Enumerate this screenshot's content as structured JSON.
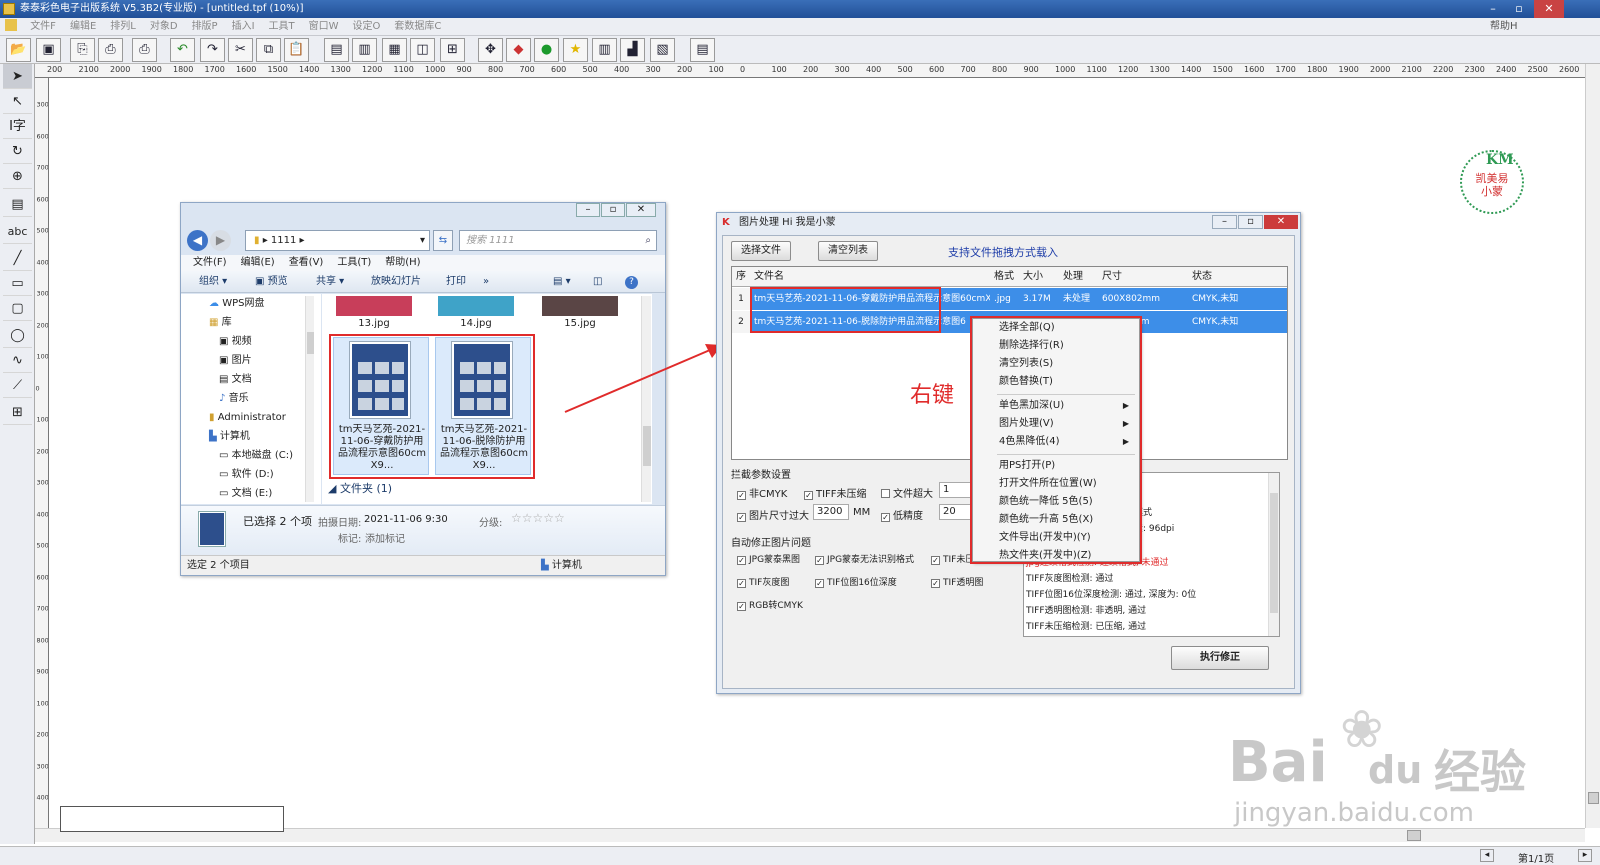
{
  "app": {
    "title": "泰泰彩色电子出版系统 V5.3B2(专业版) - [untitled.tpf (10%)]",
    "menu": [
      "文件F",
      "编辑E",
      "排列L",
      "对象D",
      "排版P",
      "插入I",
      "工具T",
      "窗口W",
      "设定O",
      "套数据库C"
    ],
    "help": "帮助H",
    "status_page": "第1/1页"
  },
  "ruler": {
    "h": [
      "200",
      "2100",
      "2000",
      "1900",
      "1800",
      "1700",
      "1600",
      "1500",
      "1400",
      "1300",
      "1200",
      "1100",
      "1000",
      "900",
      "800",
      "700",
      "600",
      "500",
      "400",
      "300",
      "200",
      "100",
      "0",
      "100",
      "200",
      "300",
      "400",
      "500",
      "600",
      "700",
      "800",
      "900",
      "1000",
      "1100",
      "1200",
      "1300",
      "1400",
      "1500",
      "1600",
      "1700",
      "1800",
      "1900",
      "2000",
      "2100",
      "2200",
      "2300",
      "2400",
      "2500",
      "2600"
    ],
    "v": [
      "300",
      "600",
      "700",
      "600",
      "500",
      "400",
      "300",
      "200",
      "100",
      "0",
      "100",
      "200",
      "300",
      "400",
      "500",
      "600",
      "700",
      "800",
      "900",
      "100",
      "200",
      "300",
      "400"
    ]
  },
  "logo": {
    "line1": "凯美易",
    "line2": "小蒙"
  },
  "explorer": {
    "path": "1111",
    "search_placeholder": "搜索 1111",
    "menu": [
      "文件(F)",
      "编辑(E)",
      "查看(V)",
      "工具(T)",
      "帮助(H)"
    ],
    "toolbar": [
      "组织 ▾",
      "预览",
      "共享 ▾",
      "放映幻灯片",
      "打印",
      "»"
    ],
    "tree": [
      "WPS网盘",
      "库",
      "视频",
      "图片",
      "文档",
      "音乐",
      "Administrator",
      "计算机",
      "本地磁盘 (C:)",
      "软件 (D:)",
      "文档 (E:)"
    ],
    "top_files": [
      "13.jpg",
      "14.jpg",
      "15.jpg"
    ],
    "files": [
      {
        "name": "tm天马艺苑-2021-11-06-穿戴防护用品流程示意图60cmX9..."
      },
      {
        "name": "tm天马艺苑-2021-11-06-脱除防护用品流程示意图60cmX9..."
      }
    ],
    "folder_group": "文件夹 (1)",
    "selected": "已选择 2 个项",
    "date_label": "拍摄日期:",
    "date_value": "2021-11-06 9:30",
    "rating_label": "分级:",
    "tag_label": "标记:",
    "tag_value": "添加标记",
    "status_left": "选定 2 个项目",
    "status_right": "计算机"
  },
  "dialog": {
    "title": "图片处理 Hi 我是小蒙",
    "btn_select": "选择文件",
    "btn_clear": "清空列表",
    "drag_hint": "支持文件拖拽方式载入",
    "columns": [
      "序",
      "文件名",
      "格式",
      "大小",
      "处理",
      "尺寸",
      "状态"
    ],
    "rows": [
      {
        "no": "1",
        "name": "tm天马艺苑-2021-11-06-穿戴防护用品流程示意图60cmX",
        "fmt": ".jpg",
        "size": "3.17M",
        "proc": "未处理",
        "dim": "600X802mm",
        "state": "CMYK,未知"
      },
      {
        "no": "2",
        "name": "tm天马艺苑-2021-11-06-脱除防护用品流程示意图6",
        "fmt": "",
        "size": "",
        "proc": "",
        "dim": "mm",
        "state": "CMYK,未知"
      }
    ],
    "annotation": "右键",
    "params_title": "拦截参数设置",
    "params": [
      {
        "label": "非CMYK",
        "checked": true
      },
      {
        "label": "TIFF未压缩",
        "checked": true
      },
      {
        "label": "文件超大",
        "checked": false,
        "value": "1"
      },
      {
        "label": "图片尺寸过大",
        "checked": true,
        "value": "3200",
        "unit": "MM"
      },
      {
        "label": "低精度",
        "checked": true,
        "value": "20"
      }
    ],
    "auto_title": "自动修正图片问题",
    "auto": [
      {
        "label": "JPG蒙泰黑图",
        "checked": true
      },
      {
        "label": "JPG蒙泰无法识别格式",
        "checked": true
      },
      {
        "label": "TIF未压缩LZW",
        "checked": true
      },
      {
        "label": "TIF灰度图",
        "checked": true
      },
      {
        "label": "TIF位图16位深度",
        "checked": true
      },
      {
        "label": "TIF透明图",
        "checked": true
      },
      {
        "label": "RGB转CMYK",
        "checked": true
      }
    ],
    "log": [
      "1",
      "模式",
      "素: 96dpi",
      "jpg连续格式检测: 连续格式, 未通过",
      "TIFF灰度图检测: 通过",
      "TIFF位图16位深度检测: 通过, 深度为: 0位",
      "TIFF透明图检测: 非透明, 通过",
      "TIFF未压缩检测: 已压缩, 通过"
    ],
    "execute": "执行修正"
  },
  "context_menu": {
    "items": [
      {
        "label": "选择全部(Q)",
        "sub": false
      },
      {
        "label": "删除选择行(R)",
        "sub": false
      },
      {
        "label": "清空列表(S)",
        "sub": false
      },
      {
        "label": "颜色替换(T)",
        "sub": false
      },
      {
        "label": "单色黑加深(U)",
        "sub": true
      },
      {
        "label": "图片处理(V)",
        "sub": true
      },
      {
        "label": "4色黑降低(4)",
        "sub": true
      },
      {
        "label": "用PS打开(P)",
        "sub": false
      },
      {
        "label": "打开文件所在位置(W)",
        "sub": false
      },
      {
        "label": "颜色统一降低 5色(5)",
        "sub": false
      },
      {
        "label": "颜色统一升高 5色(X)",
        "sub": false
      },
      {
        "label": "文件导出(开发中)(Y)",
        "sub": false
      },
      {
        "label": "热文件夹(开发中)(Z)",
        "sub": false
      }
    ]
  },
  "watermark": {
    "brand": "Bai",
    "du": "du",
    "jy": "经验",
    "url": "jingyan.baidu.com"
  },
  "colors": {
    "accent": "#3d8ee8",
    "red": "#e02b2b",
    "selection": "#3d8ee8"
  }
}
